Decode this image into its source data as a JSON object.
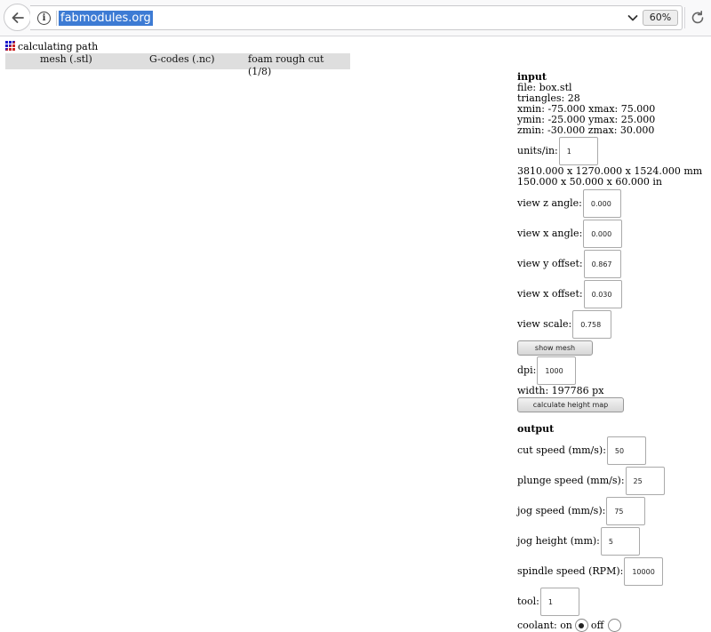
{
  "browser": {
    "url": "fabmodules.org",
    "zoom": "60%"
  },
  "page": {
    "status": "calculating path",
    "tabs": [
      "mesh (.stl)",
      "G-codes (.nc)",
      "foam rough cut (1/8)"
    ]
  },
  "input": {
    "heading": "input",
    "file": "file: box.stl",
    "triangles": "triangles: 28",
    "xrange": "xmin: -75.000 xmax: 75.000",
    "yrange": "ymin: -25.000 ymax: 25.000",
    "zrange": "zmin: -30.000 zmax: 30.000",
    "units_label": "units/in:",
    "units_value": "1",
    "size_mm": "3810.000 x 1270.000 x 1524.000 mm",
    "size_in": "150.000 x 50.000 x 60.000 in",
    "view_z_label": "view z angle:",
    "view_z_value": "0.000",
    "view_x_label": "view x angle:",
    "view_x_value": "0.000",
    "view_y_off_label": "view y offset:",
    "view_y_off_value": "0.867",
    "view_x_off_label": "view x offset:",
    "view_x_off_value": "0.030",
    "view_scale_label": "view scale:",
    "view_scale_value": "0.758",
    "show_mesh": "show mesh",
    "dpi_label": "dpi:",
    "dpi_value": "1000",
    "width": "width: 197786 px",
    "calc_height_map": "calculate height map"
  },
  "output": {
    "heading": "output",
    "cut_speed_label": "cut speed (mm/s):",
    "cut_speed_value": "50",
    "plunge_speed_label": "plunge speed (mm/s):",
    "plunge_speed_value": "25",
    "jog_speed_label": "jog speed (mm/s):",
    "jog_speed_value": "75",
    "jog_height_label": "jog height (mm):",
    "jog_height_value": "5",
    "spindle_label": "spindle speed (RPM):",
    "spindle_value": "10000",
    "tool_label": "tool:",
    "tool_value": "1",
    "coolant_label": "coolant: on",
    "coolant_off": "off",
    "coolant_selected": "on"
  }
}
